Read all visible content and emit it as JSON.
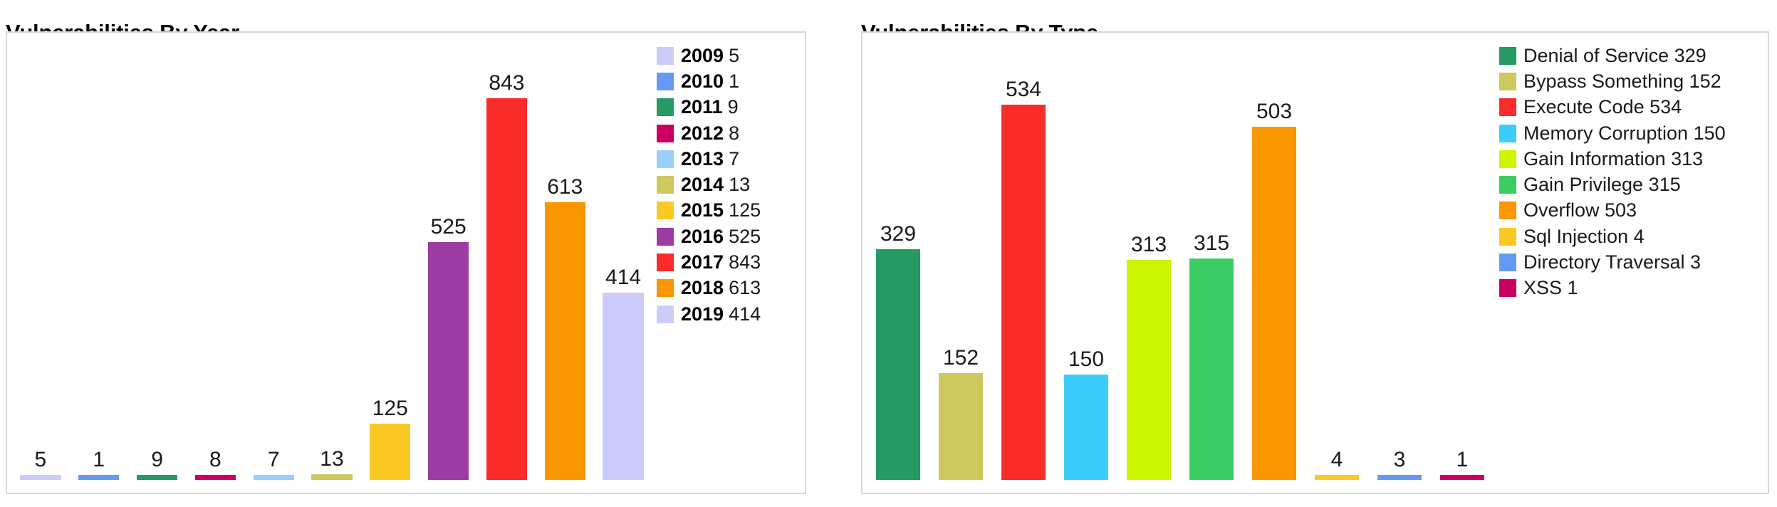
{
  "charts": [
    {
      "id": "vulnerabilities-by-year",
      "title": "Vulnerabilities By Year",
      "legend_bold_label": true
    },
    {
      "id": "vulnerabilities-by-type",
      "title": "Vulnerabilities By Type",
      "legend_bold_label": false
    }
  ],
  "chart_data": [
    {
      "type": "bar",
      "title": "Vulnerabilities By Year",
      "xlabel": "",
      "ylabel": "",
      "ylim": [
        0,
        900
      ],
      "grid": false,
      "legend_position": "right",
      "categories": [
        "2009",
        "2010",
        "2011",
        "2012",
        "2013",
        "2014",
        "2015",
        "2016",
        "2017",
        "2018",
        "2019"
      ],
      "values": [
        5,
        1,
        9,
        8,
        7,
        13,
        125,
        525,
        843,
        613,
        414
      ],
      "colors": [
        "#ccccfa",
        "#6699f5",
        "#259a63",
        "#c90062",
        "#99cffa",
        "#ccca5f",
        "#fcc823",
        "#9c3ba1",
        "#fa2b2b",
        "#fa9600",
        "#ccccfa"
      ],
      "data_labels": [
        "5",
        "1",
        "9",
        "8",
        "7",
        "13",
        "125",
        "525",
        "843",
        "613",
        "414"
      ],
      "legend": [
        {
          "label": "2009",
          "value": "5",
          "color": "#ccccfa"
        },
        {
          "label": "2010",
          "value": "1",
          "color": "#6699f5"
        },
        {
          "label": "2011",
          "value": "9",
          "color": "#259a63"
        },
        {
          "label": "2012",
          "value": "8",
          "color": "#c90062"
        },
        {
          "label": "2013",
          "value": "7",
          "color": "#99cffa"
        },
        {
          "label": "2014",
          "value": "13",
          "color": "#ccca5f"
        },
        {
          "label": "2015",
          "value": "125",
          "color": "#fcc823"
        },
        {
          "label": "2016",
          "value": "525",
          "color": "#9c3ba1"
        },
        {
          "label": "2017",
          "value": "843",
          "color": "#fa2b2b"
        },
        {
          "label": "2018",
          "value": "613",
          "color": "#fa9600"
        },
        {
          "label": "2019",
          "value": "414",
          "color": "#ccccfa"
        }
      ]
    },
    {
      "type": "bar",
      "title": "Vulnerabilities By Type",
      "xlabel": "",
      "ylabel": "",
      "ylim": [
        0,
        580
      ],
      "grid": false,
      "legend_position": "right",
      "categories": [
        "Denial of Service",
        "Bypass Something",
        "Execute Code",
        "Memory Corruption",
        "Gain Information",
        "Gain Privilege",
        "Overflow",
        "Sql Injection",
        "Directory Traversal",
        "XSS"
      ],
      "values": [
        329,
        152,
        534,
        150,
        313,
        315,
        503,
        4,
        3,
        1
      ],
      "colors": [
        "#259a63",
        "#ccca5f",
        "#fa2b2b",
        "#3bcdfa",
        "#ccf500",
        "#3bcd63",
        "#fa9600",
        "#fcc823",
        "#6699f5",
        "#c90062"
      ],
      "data_labels": [
        "329",
        "152",
        "534",
        "150",
        "313",
        "315",
        "503",
        "4",
        "3",
        "1"
      ],
      "legend": [
        {
          "label": "Denial of Service 329",
          "color": "#259a63"
        },
        {
          "label": "Bypass Something 152",
          "color": "#ccca5f"
        },
        {
          "label": "Execute Code 534",
          "color": "#fa2b2b"
        },
        {
          "label": "Memory Corruption 150",
          "color": "#3bcdfa"
        },
        {
          "label": "Gain Information 313",
          "color": "#ccf500"
        },
        {
          "label": "Gain Privilege 315",
          "color": "#3bcd63"
        },
        {
          "label": "Overflow 503",
          "color": "#fa9600"
        },
        {
          "label": "Sql Injection 4",
          "color": "#fcc823"
        },
        {
          "label": "Directory Traversal 3",
          "color": "#6699f5"
        },
        {
          "label": "XSS 1",
          "color": "#c90062"
        }
      ]
    }
  ]
}
